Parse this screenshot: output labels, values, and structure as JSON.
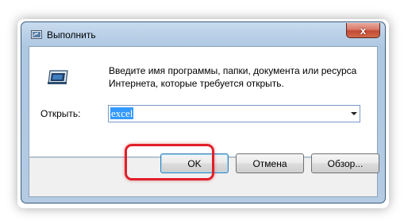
{
  "window": {
    "title": "Выполнить",
    "close_label": "x"
  },
  "dialog": {
    "description": "Введите имя программы, папки, документа или ресурса Интернета, которые требуется открыть.",
    "open_label": "Открыть:",
    "open_value": "excel"
  },
  "buttons": {
    "ok": "OK",
    "cancel": "Отмена",
    "browse": "Обзор..."
  },
  "colors": {
    "highlight": "#e0202a",
    "selection": "#3399ff",
    "close_button": "#c24a34"
  }
}
